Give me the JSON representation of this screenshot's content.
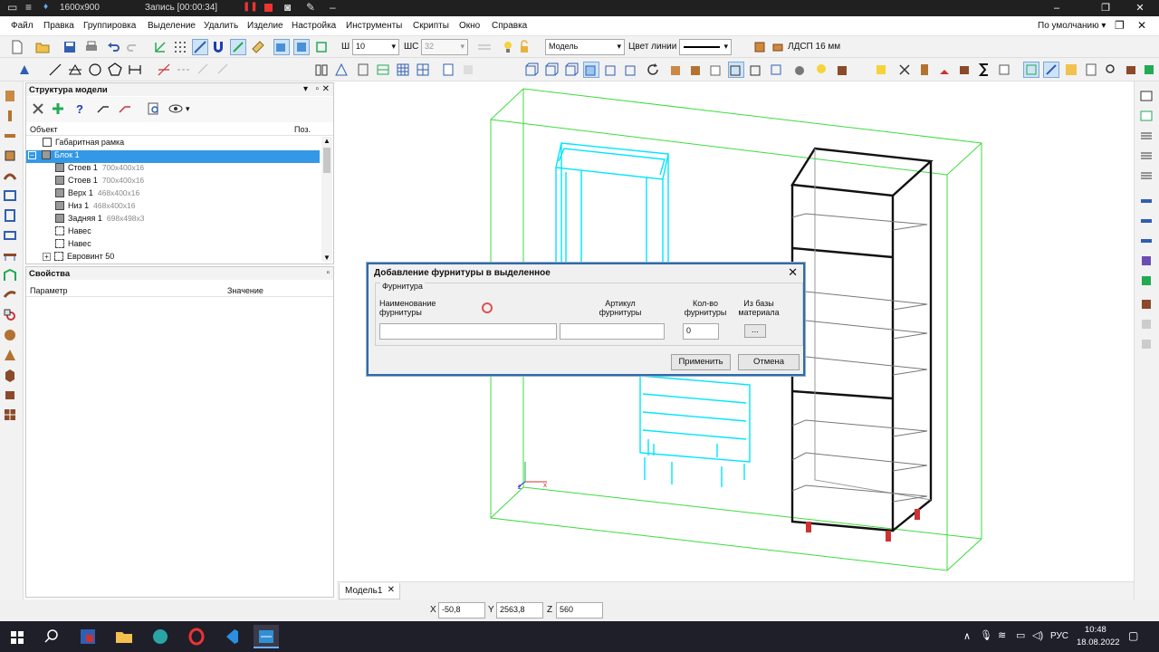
{
  "titlebar": {
    "resolution": "1600x900",
    "recording": "Запись [00:00:34]"
  },
  "menu": [
    "Файл",
    "Правка",
    "Группировка",
    "Выделение",
    "Удалить",
    "Изделие",
    "Настройка",
    "Инструменты",
    "Скрипты",
    "Окно",
    "Справка"
  ],
  "profile_dropdown": "По умолчанию",
  "toolbar": {
    "w_label": "Ш",
    "w_value": "10",
    "shs_label": "ШС",
    "shs_value": "32",
    "layer_value": "Модель",
    "line_color_label": "Цвет линии",
    "material_value": "ЛДСП 16 мм"
  },
  "structure_panel": {
    "title": "Структура модели",
    "col_object": "Объект",
    "col_pos": "Поз.",
    "rows": [
      {
        "name": "Габаритная рамка",
        "dim": ""
      },
      {
        "name": "Блок 1",
        "dim": ""
      },
      {
        "name": "Стоев 1",
        "dim": "700x400x16"
      },
      {
        "name": "Стоев 1",
        "dim": "700x400x16"
      },
      {
        "name": "Верх 1",
        "dim": "468x400x16"
      },
      {
        "name": "Низ 1",
        "dim": "468x400x16"
      },
      {
        "name": "Задняя 1",
        "dim": "698x498x3"
      },
      {
        "name": "Навес",
        "dim": ""
      },
      {
        "name": "Навес",
        "dim": ""
      },
      {
        "name": "Евровинт 50",
        "dim": ""
      }
    ]
  },
  "properties_panel": {
    "title": "Свойства",
    "col_param": "Параметр",
    "col_value": "Значение"
  },
  "dialog": {
    "title": "Добавление фурнитуры в выделенное",
    "group_title": "Фурнитура",
    "col_name": "Наименование фурнитуры",
    "col_article": "Артикул фурнитуры",
    "col_qty": "Кол-во фурнитуры",
    "col_base": "Из базы материала",
    "name_value": "",
    "article_value": "",
    "qty_value": "0",
    "browse_label": "...",
    "apply_label": "Применить",
    "cancel_label": "Отмена"
  },
  "doc_tab": "Модель1",
  "coords": {
    "x_label": "X",
    "x_value": "-50,8",
    "y_label": "Y",
    "y_value": "2563,8",
    "z_label": "Z",
    "z_value": "560"
  },
  "taskbar": {
    "lang": "РУС",
    "time": "10:48",
    "date": "18.08.2022"
  },
  "colors": {
    "cyan_model": "#00e5ff",
    "frame_green": "#3cdc3c",
    "selection_blue": "#3399e6",
    "dialog_border": "#2b6cb0"
  }
}
